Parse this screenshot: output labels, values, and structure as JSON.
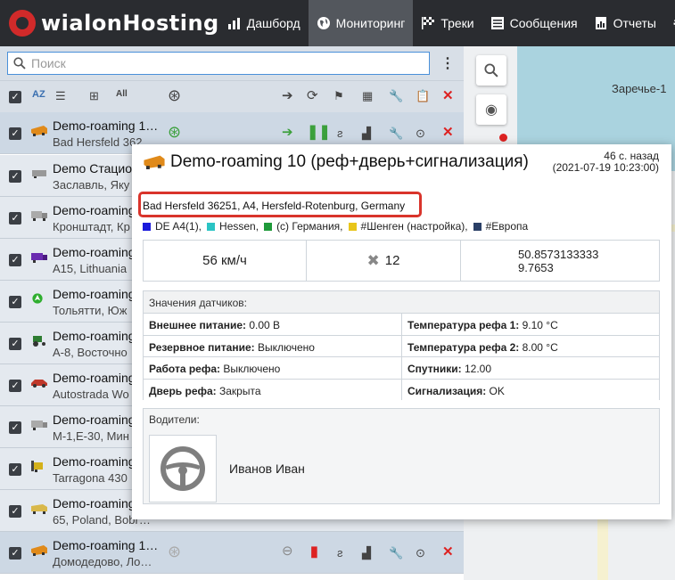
{
  "app": {
    "logo": "wialonHosting"
  },
  "nav": [
    {
      "label": "Дашборд",
      "icon": "chart-icon"
    },
    {
      "label": "Мониторинг",
      "icon": "globe-icon",
      "active": true
    },
    {
      "label": "Треки",
      "icon": "flag-icon"
    },
    {
      "label": "Сообщения",
      "icon": "messages-icon"
    },
    {
      "label": "Отчеты",
      "icon": "report-icon"
    }
  ],
  "search": {
    "placeholder": "Поиск",
    "value": ""
  },
  "units": [
    {
      "name": "Demo-roaming 1…",
      "addr": "Bad Hersfeld 362…",
      "icon": "truck-orange",
      "selected": true
    },
    {
      "name": "Demo Стацион",
      "addr": "Заславль, Яку",
      "icon": "trailer-grey"
    },
    {
      "name": "Demo-roaming",
      "addr": "Кронштадт, Кр",
      "icon": "truck-grey"
    },
    {
      "name": "Demo-roaming",
      "addr": "A15, Lithuania",
      "icon": "truck-purple"
    },
    {
      "name": "Demo-roaming",
      "addr": "Тольятти, Юж",
      "icon": "arrow-green"
    },
    {
      "name": "Demo-roaming",
      "addr": "A-8, Восточно",
      "icon": "tractor-green"
    },
    {
      "name": "Demo-roaming",
      "addr": "Autostrada Wo",
      "icon": "car-red"
    },
    {
      "name": "Demo-roaming",
      "addr": "M-1,E-30, Мин",
      "icon": "truck-grey"
    },
    {
      "name": "Demo-roaming",
      "addr": "Tarragona 430",
      "icon": "loader-yellow"
    },
    {
      "name": "Demo-roaming",
      "addr": "65, Poland, Bobr…",
      "icon": "truck-yellow"
    },
    {
      "name": "Demo-roaming 1…",
      "addr": "Домодедово, Ло…",
      "icon": "truck-orange",
      "selected": true
    }
  ],
  "map": {
    "label": "Заречье-1"
  },
  "popup": {
    "title": "Demo-roaming 10 (реф+дверь+сигнализация)",
    "time_ago": "46 с. назад",
    "timestamp": "(2021-07-19 10:23:00)",
    "address": "Bad Hersfeld 36251, A4, Hersfeld-Rotenburg, Germany",
    "geofences": [
      {
        "label": "DE A4(1),",
        "color": "#1a1adb"
      },
      {
        "label": "Hessen,",
        "color": "#2bc4c4"
      },
      {
        "label": "(c) Германия,",
        "color": "#1f9a3a"
      },
      {
        "label": "#Шенген (настройка),",
        "color": "#e8c51a"
      },
      {
        "label": "#Европа",
        "color": "#2a3f66"
      }
    ],
    "speed": "56 км/ч",
    "satellites": "12",
    "lat": "50.8573133333",
    "lon": "9.7653",
    "sensors_title": "Значения датчиков:",
    "sensors": [
      {
        "name": "Внешнее питание:",
        "value": "0.00 В"
      },
      {
        "name": "Температура рефа 1:",
        "value": "9.10 °C"
      },
      {
        "name": "Резервное питание:",
        "value": "Выключено"
      },
      {
        "name": "Температура рефа 2:",
        "value": "8.00 °C"
      },
      {
        "name": "Работа рефа:",
        "value": "Выключено"
      },
      {
        "name": "Спутники:",
        "value": "12.00"
      },
      {
        "name": "Дверь рефа:",
        "value": "Закрыта"
      },
      {
        "name": "Сигнализация:",
        "value": "OK"
      }
    ],
    "drivers_title": "Водители:",
    "driver_name": "Иванов Иван"
  }
}
